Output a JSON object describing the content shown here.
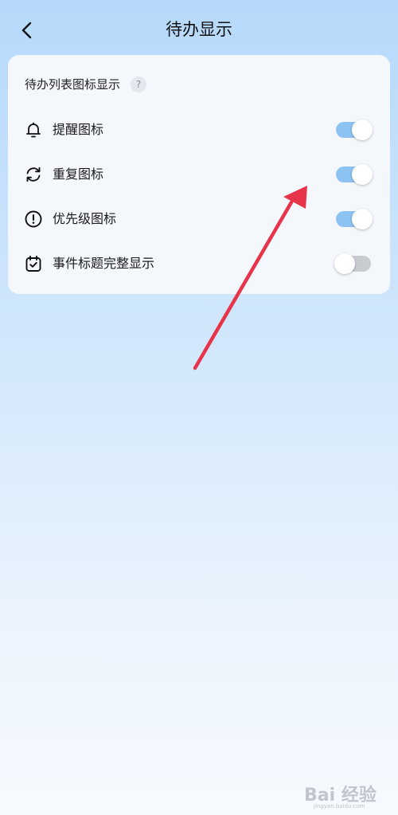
{
  "header": {
    "title": "待办显示",
    "back_icon": "chevron-left-icon"
  },
  "section": {
    "title": "待办列表图标显示",
    "help_label": "?"
  },
  "settings": [
    {
      "label": "提醒图标",
      "icon": "bell-icon",
      "enabled": true
    },
    {
      "label": "重复图标",
      "icon": "refresh-icon",
      "enabled": true
    },
    {
      "label": "优先级图标",
      "icon": "exclamation-circle-icon",
      "enabled": true
    },
    {
      "label": "事件标题完整显示",
      "icon": "calendar-check-icon",
      "enabled": false
    }
  ],
  "colors": {
    "toggle_on": "#8cc3f2",
    "toggle_off": "#c8cbd0",
    "annotation_arrow": "#e8344a"
  },
  "watermark": {
    "text": "Bai 经验",
    "sub": "jingyan.baidu.com"
  }
}
